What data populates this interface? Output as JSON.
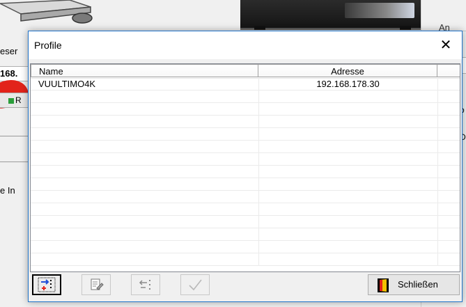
{
  "background": {
    "left_text_1": "eser",
    "ip_fragment": "168.",
    "button_fragment": "R",
    "left_text_2": "e In",
    "right_group_label": "An",
    "right_fragment_1": "o",
    "right_fragment_2": "De",
    "right_fragment_3": "r"
  },
  "dialog": {
    "title": "Profile",
    "close_glyph": "✕",
    "columns": {
      "name": "Name",
      "address": "Adresse"
    },
    "rows": [
      {
        "name": "VUULTIMO4K",
        "address": "192.168.178.30"
      }
    ],
    "empty_rows": 14,
    "toolbar": {
      "add_icon": "add-profile-icon",
      "edit_icon": "edit-profile-icon",
      "remove_icon": "remove-profile-icon",
      "apply_icon": "checkmark-icon",
      "close_label": "Schließen",
      "close_icon": "exit-door-icon"
    }
  },
  "colors": {
    "dialog_border": "#1e72c8",
    "accent_red": "#e2231a",
    "icon_blue": "#1f4fd8",
    "door_yellow": "#f2c200"
  }
}
